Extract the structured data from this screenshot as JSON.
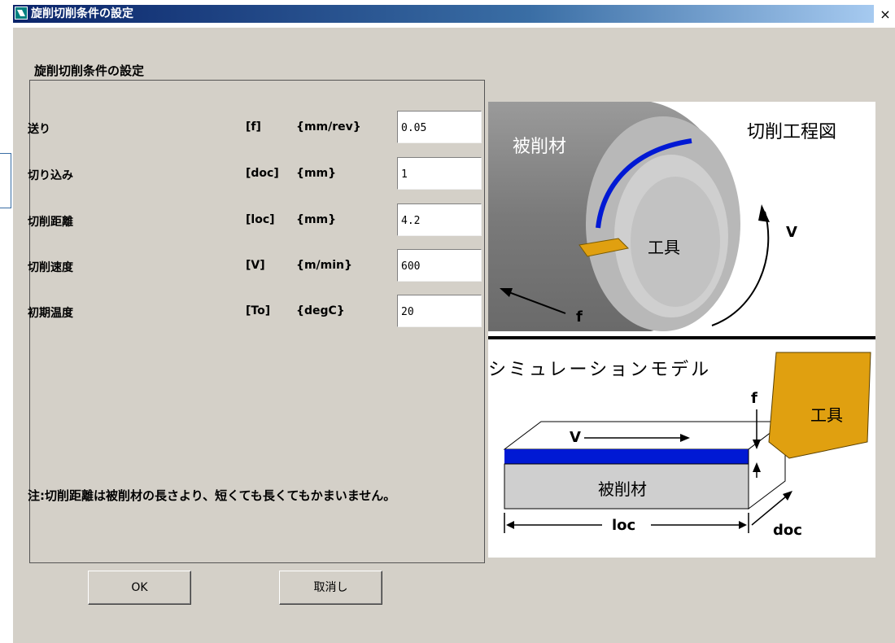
{
  "window": {
    "title": "旋削切削条件の設定",
    "close_glyph": "×"
  },
  "section_title": "旋削切削条件の設定",
  "params": [
    {
      "label": "送り",
      "symbol": "[f]",
      "unit": "{mm/rev}",
      "value": "0.05"
    },
    {
      "label": "切り込み",
      "symbol": "[doc]",
      "unit": "{mm}",
      "value": "1"
    },
    {
      "label": "切削距離",
      "symbol": "[loc]",
      "unit": "{mm}",
      "value": "4.2"
    },
    {
      "label": "切削速度",
      "symbol": "[V]",
      "unit": "{m/min}",
      "value": "600"
    },
    {
      "label": "初期温度",
      "symbol": "[To]",
      "unit": "{degC}",
      "value": "20"
    }
  ],
  "note": "注:切削距離は被削材の長さより、短くても長くてもかまいません。",
  "buttons": {
    "ok": "OK",
    "cancel": "取消し"
  },
  "diagram": {
    "top_title": "切削工程図",
    "workpiece": "被削材",
    "tool": "工具",
    "v": "V",
    "f": "f",
    "model_title": "シミュレーションモデル",
    "model_workpiece": "被削材",
    "model_tool": "工具",
    "loc": "loc",
    "doc": "doc"
  },
  "colors": {
    "chip_blue": "#0019d4",
    "tool_orange": "#e0a010",
    "workpiece_gray": "#8a8a8a",
    "title_blue": "#0a246a"
  }
}
